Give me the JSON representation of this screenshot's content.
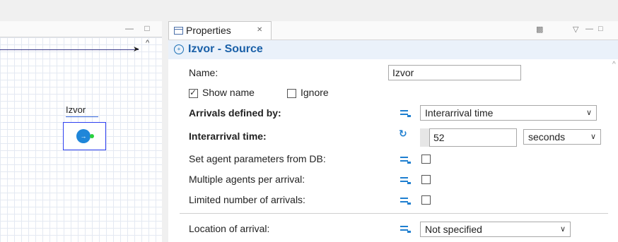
{
  "left_panel": {
    "node": {
      "label": "Izvor",
      "icon": "source-block-icon"
    }
  },
  "properties_tab": {
    "label": "Properties",
    "close_symbol": "✕"
  },
  "element_title": {
    "text": "Izvor - Source",
    "icon": "source-icon"
  },
  "fields": {
    "name": {
      "label": "Name:",
      "value": "Izvor"
    },
    "show_name": {
      "label": "Show name",
      "checked": true
    },
    "ignore": {
      "label": "Ignore",
      "checked": false
    },
    "arrivals_defined_by": {
      "label": "Arrivals defined by:",
      "value": "Interarrival time"
    },
    "interarrival_time": {
      "label": "Interarrival time:",
      "value": "52",
      "unit": "seconds"
    },
    "set_agent_params": {
      "label": "Set agent parameters from DB:",
      "checked": false
    },
    "multiple_agents": {
      "label": "Multiple agents per arrival:",
      "checked": false
    },
    "limited_arrivals": {
      "label": "Limited number of arrivals:",
      "checked": false
    },
    "location_of_arrival": {
      "label": "Location of arrival:",
      "value": "Not specified"
    }
  },
  "colors": {
    "accent": "#1f7fd0",
    "title_text": "#1a60a8",
    "title_bg": "#eaf1fa",
    "selection_border": "#2d3ff0",
    "port_green": "#2ad13d"
  }
}
